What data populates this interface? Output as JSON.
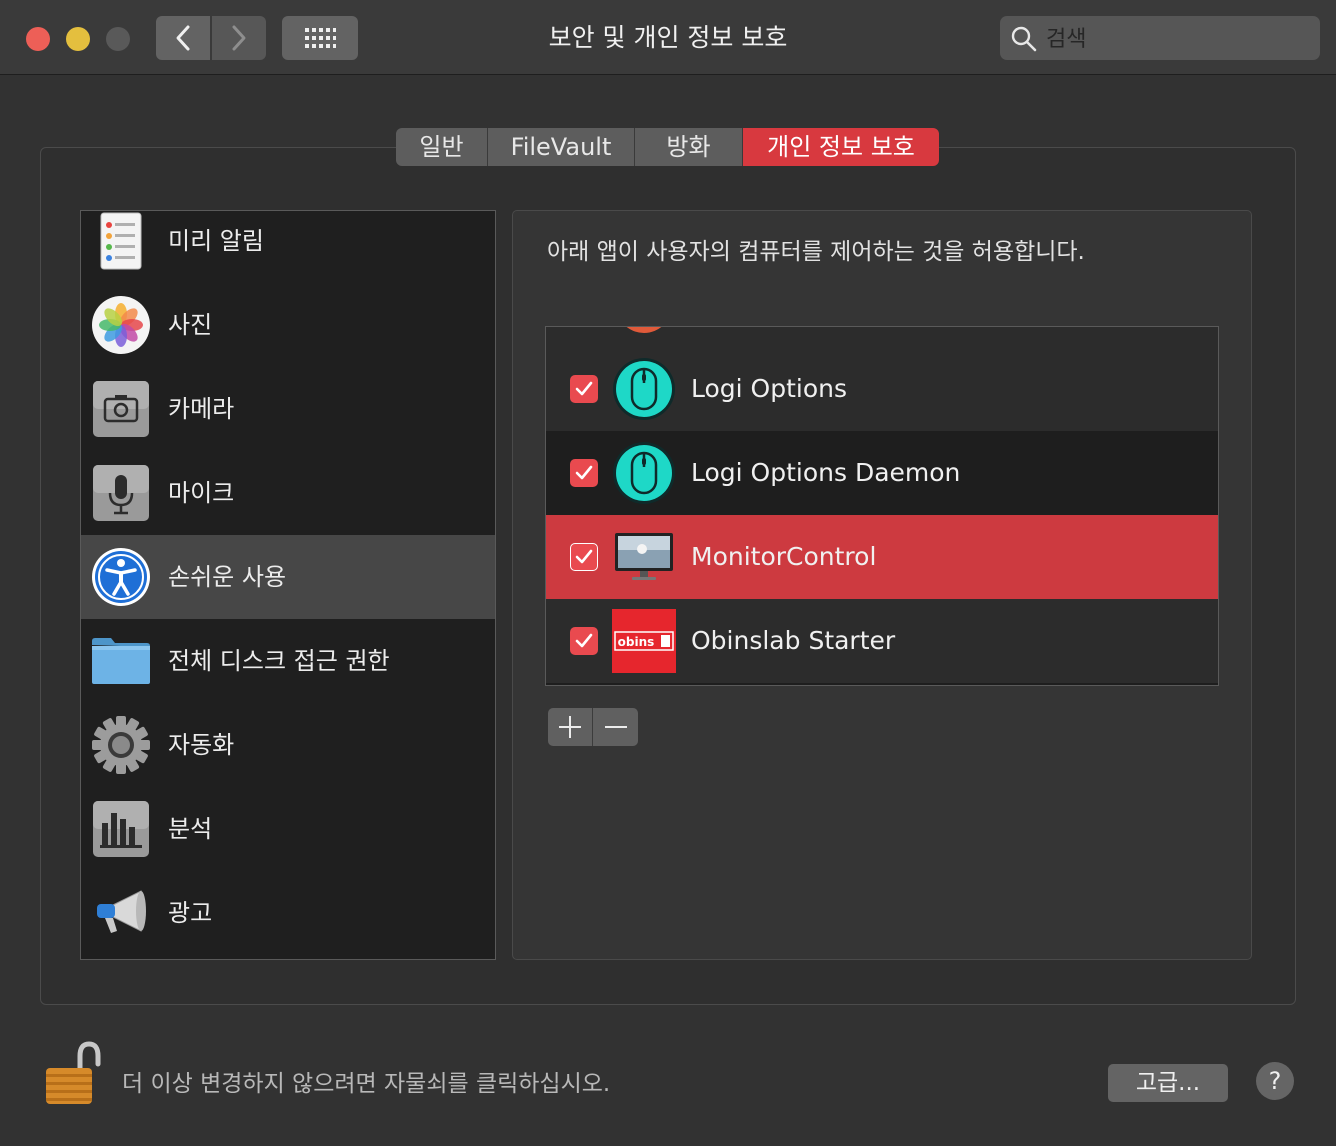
{
  "window": {
    "title": "보안 및 개인 정보 보호",
    "search_placeholder": "검색"
  },
  "tabs": [
    {
      "label": "일반",
      "active": false
    },
    {
      "label": "FileVault",
      "active": false
    },
    {
      "label": "방화벽",
      "active": false
    },
    {
      "label": "개인 정보 보호",
      "active": true
    }
  ],
  "sidebar": {
    "items": [
      {
        "label": "미리 알림",
        "icon": "reminders-icon"
      },
      {
        "label": "사진",
        "icon": "photos-icon"
      },
      {
        "label": "카메라",
        "icon": "camera-icon"
      },
      {
        "label": "마이크",
        "icon": "microphone-icon"
      },
      {
        "label": "손쉬운 사용",
        "icon": "accessibility-icon",
        "selected": true
      },
      {
        "label": "전체 디스크 접근 권한",
        "icon": "folder-icon"
      },
      {
        "label": "자동화",
        "icon": "gear-icon"
      },
      {
        "label": "분석",
        "icon": "analytics-icon"
      },
      {
        "label": "광고",
        "icon": "megaphone-icon"
      }
    ]
  },
  "main": {
    "description": "아래 앱이 사용자의 컴퓨터를 제어하는 것을 허용합니다.",
    "apps": [
      {
        "name": "Logi Options",
        "checked": true,
        "icon": "logi-mouse-icon"
      },
      {
        "name": "Logi Options Daemon",
        "checked": true,
        "icon": "logi-mouse-icon"
      },
      {
        "name": "MonitorControl",
        "checked": true,
        "icon": "monitor-icon",
        "selected": true
      },
      {
        "name": "Obinslab Starter",
        "checked": true,
        "icon": "obins-logo-icon",
        "logo_text": "obins"
      }
    ],
    "add_label": "+",
    "remove_label": "−"
  },
  "footer": {
    "lock_text": "더 이상 변경하지 않으려면 자물쇠를 클릭하십시오.",
    "advanced_label": "고급...",
    "help_label": "?"
  },
  "colors": {
    "accent": "#d8393f",
    "background": "#323232"
  }
}
